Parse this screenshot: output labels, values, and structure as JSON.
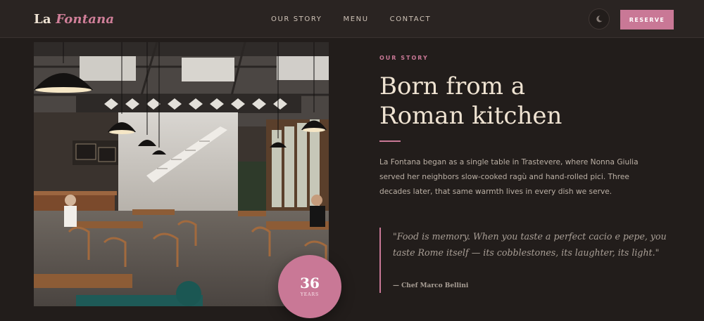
{
  "header": {
    "logo_main": "La",
    "logo_accent": "Fontana",
    "nav": [
      {
        "label": "OUR STORY"
      },
      {
        "label": "MENU"
      },
      {
        "label": "CONTACT"
      }
    ],
    "theme_toggle_icon": "moon-icon",
    "reserve_label": "RESERVE"
  },
  "colors": {
    "background": "#221d1b",
    "header_bg": "#2a2422",
    "accent": "#c97896",
    "headline": "#efe3d2"
  },
  "photo": {
    "badge_number": "36",
    "badge_label": "YEARS"
  },
  "story": {
    "eyebrow": "OUR STORY",
    "headline_line1": "Born from a",
    "headline_line2": "Roman kitchen",
    "body": "La Fontana began as a single table in Trastevere, where Nonna Giulia served her neighbors slow-cooked ragù and hand-rolled pici. Three decades later, that same warmth lives in every dish we serve.",
    "quote": "\"Food is memory. When you taste a perfect cacio e pepe, you taste Rome itself — its cobblestones, its laughter, its light.\"",
    "attribution": "— Chef Marco Bellini"
  }
}
